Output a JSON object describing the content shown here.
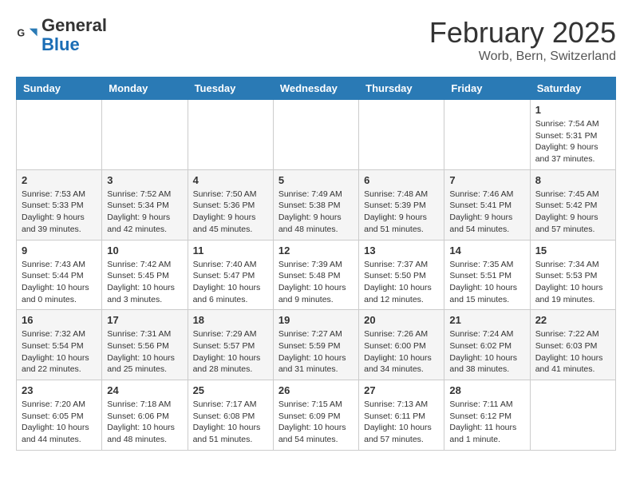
{
  "header": {
    "logo_general": "General",
    "logo_blue": "Blue",
    "month": "February 2025",
    "location": "Worb, Bern, Switzerland"
  },
  "days_of_week": [
    "Sunday",
    "Monday",
    "Tuesday",
    "Wednesday",
    "Thursday",
    "Friday",
    "Saturday"
  ],
  "weeks": [
    [
      {
        "day": "",
        "info": ""
      },
      {
        "day": "",
        "info": ""
      },
      {
        "day": "",
        "info": ""
      },
      {
        "day": "",
        "info": ""
      },
      {
        "day": "",
        "info": ""
      },
      {
        "day": "",
        "info": ""
      },
      {
        "day": "1",
        "info": "Sunrise: 7:54 AM\nSunset: 5:31 PM\nDaylight: 9 hours and 37 minutes."
      }
    ],
    [
      {
        "day": "2",
        "info": "Sunrise: 7:53 AM\nSunset: 5:33 PM\nDaylight: 9 hours and 39 minutes."
      },
      {
        "day": "3",
        "info": "Sunrise: 7:52 AM\nSunset: 5:34 PM\nDaylight: 9 hours and 42 minutes."
      },
      {
        "day": "4",
        "info": "Sunrise: 7:50 AM\nSunset: 5:36 PM\nDaylight: 9 hours and 45 minutes."
      },
      {
        "day": "5",
        "info": "Sunrise: 7:49 AM\nSunset: 5:38 PM\nDaylight: 9 hours and 48 minutes."
      },
      {
        "day": "6",
        "info": "Sunrise: 7:48 AM\nSunset: 5:39 PM\nDaylight: 9 hours and 51 minutes."
      },
      {
        "day": "7",
        "info": "Sunrise: 7:46 AM\nSunset: 5:41 PM\nDaylight: 9 hours and 54 minutes."
      },
      {
        "day": "8",
        "info": "Sunrise: 7:45 AM\nSunset: 5:42 PM\nDaylight: 9 hours and 57 minutes."
      }
    ],
    [
      {
        "day": "9",
        "info": "Sunrise: 7:43 AM\nSunset: 5:44 PM\nDaylight: 10 hours and 0 minutes."
      },
      {
        "day": "10",
        "info": "Sunrise: 7:42 AM\nSunset: 5:45 PM\nDaylight: 10 hours and 3 minutes."
      },
      {
        "day": "11",
        "info": "Sunrise: 7:40 AM\nSunset: 5:47 PM\nDaylight: 10 hours and 6 minutes."
      },
      {
        "day": "12",
        "info": "Sunrise: 7:39 AM\nSunset: 5:48 PM\nDaylight: 10 hours and 9 minutes."
      },
      {
        "day": "13",
        "info": "Sunrise: 7:37 AM\nSunset: 5:50 PM\nDaylight: 10 hours and 12 minutes."
      },
      {
        "day": "14",
        "info": "Sunrise: 7:35 AM\nSunset: 5:51 PM\nDaylight: 10 hours and 15 minutes."
      },
      {
        "day": "15",
        "info": "Sunrise: 7:34 AM\nSunset: 5:53 PM\nDaylight: 10 hours and 19 minutes."
      }
    ],
    [
      {
        "day": "16",
        "info": "Sunrise: 7:32 AM\nSunset: 5:54 PM\nDaylight: 10 hours and 22 minutes."
      },
      {
        "day": "17",
        "info": "Sunrise: 7:31 AM\nSunset: 5:56 PM\nDaylight: 10 hours and 25 minutes."
      },
      {
        "day": "18",
        "info": "Sunrise: 7:29 AM\nSunset: 5:57 PM\nDaylight: 10 hours and 28 minutes."
      },
      {
        "day": "19",
        "info": "Sunrise: 7:27 AM\nSunset: 5:59 PM\nDaylight: 10 hours and 31 minutes."
      },
      {
        "day": "20",
        "info": "Sunrise: 7:26 AM\nSunset: 6:00 PM\nDaylight: 10 hours and 34 minutes."
      },
      {
        "day": "21",
        "info": "Sunrise: 7:24 AM\nSunset: 6:02 PM\nDaylight: 10 hours and 38 minutes."
      },
      {
        "day": "22",
        "info": "Sunrise: 7:22 AM\nSunset: 6:03 PM\nDaylight: 10 hours and 41 minutes."
      }
    ],
    [
      {
        "day": "23",
        "info": "Sunrise: 7:20 AM\nSunset: 6:05 PM\nDaylight: 10 hours and 44 minutes."
      },
      {
        "day": "24",
        "info": "Sunrise: 7:18 AM\nSunset: 6:06 PM\nDaylight: 10 hours and 48 minutes."
      },
      {
        "day": "25",
        "info": "Sunrise: 7:17 AM\nSunset: 6:08 PM\nDaylight: 10 hours and 51 minutes."
      },
      {
        "day": "26",
        "info": "Sunrise: 7:15 AM\nSunset: 6:09 PM\nDaylight: 10 hours and 54 minutes."
      },
      {
        "day": "27",
        "info": "Sunrise: 7:13 AM\nSunset: 6:11 PM\nDaylight: 10 hours and 57 minutes."
      },
      {
        "day": "28",
        "info": "Sunrise: 7:11 AM\nSunset: 6:12 PM\nDaylight: 11 hours and 1 minute."
      },
      {
        "day": "",
        "info": ""
      }
    ]
  ]
}
